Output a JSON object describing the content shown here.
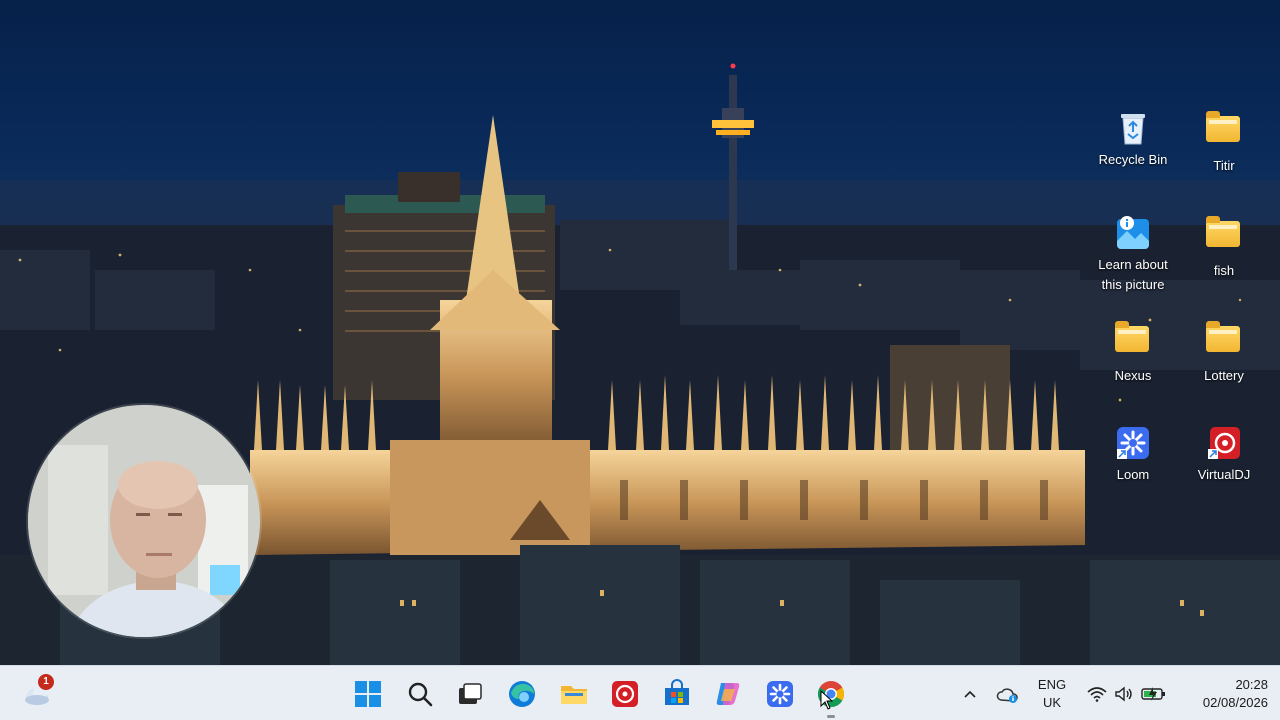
{
  "desktop": {
    "icons": [
      {
        "label": "Recycle Bin",
        "icon": "recycle-bin-icon"
      },
      {
        "label": "Titir",
        "icon": "folder-icon"
      },
      {
        "label_line1": "Learn about",
        "label_line2": "this picture",
        "icon": "learn-about-picture-icon"
      },
      {
        "label": "fish",
        "icon": "folder-icon"
      },
      {
        "label": "Nexus",
        "icon": "folder-icon"
      },
      {
        "label": "Lottery",
        "icon": "folder-icon"
      },
      {
        "label": "Loom",
        "icon": "loom-icon"
      },
      {
        "label": "VirtualDJ",
        "icon": "virtualdj-icon"
      }
    ]
  },
  "taskbar": {
    "weather_badge": "1",
    "apps": [
      {
        "name": "Start",
        "icon": "windows-start-icon"
      },
      {
        "name": "Search",
        "icon": "search-icon"
      },
      {
        "name": "Task View",
        "icon": "task-view-icon"
      },
      {
        "name": "Microsoft Edge",
        "icon": "edge-icon"
      },
      {
        "name": "File Explorer",
        "icon": "file-explorer-icon"
      },
      {
        "name": "VirtualDJ",
        "icon": "virtualdj-icon"
      },
      {
        "name": "Microsoft Store",
        "icon": "store-icon"
      },
      {
        "name": "Copilot",
        "icon": "copilot-icon"
      },
      {
        "name": "Loom",
        "icon": "loom-icon"
      },
      {
        "name": "Google Chrome",
        "icon": "chrome-icon"
      }
    ],
    "tray": {
      "language_line1": "ENG",
      "language_line2": "UK",
      "time": "20:28",
      "date": "02/08/2026"
    }
  },
  "colors": {
    "taskbar_bg": "#e9eef4",
    "folder_yellow": "#f2b632",
    "edge_blue": "#0f7cd8",
    "chrome_red": "#db4437",
    "loom_blue": "#3b6cf0"
  }
}
